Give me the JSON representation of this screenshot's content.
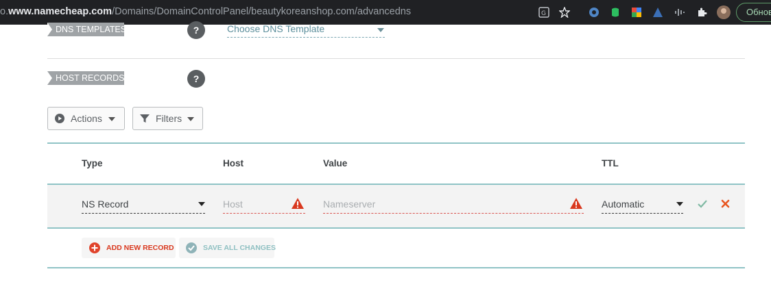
{
  "browser": {
    "url_prefix": "o.",
    "url_domain": "www.namecheap.com",
    "url_path": "/Domains/DomainControlPanel/beautykoreanshop.com/advancedns",
    "update_label": "Обнов"
  },
  "dns_templates": {
    "label": "DNS TEMPLATES",
    "help": "?",
    "select_value": "Choose DNS Template"
  },
  "host_records": {
    "label": "HOST RECORDS",
    "help": "?"
  },
  "toolbar": {
    "actions_label": "Actions",
    "filters_label": "Filters"
  },
  "table": {
    "columns": [
      "Type",
      "Host",
      "Value",
      "TTL"
    ],
    "row": {
      "type": "NS Record",
      "host_placeholder": "Host",
      "value_placeholder": "Nameserver",
      "ttl": "Automatic"
    }
  },
  "footer": {
    "add_label": "ADD NEW RECORD",
    "save_label": "SAVE ALL CHANGES"
  },
  "colors": {
    "accent_teal": "#8fc3c5",
    "error_red": "#d9534f",
    "confirm_green": "#7fb9a3",
    "cancel_orange": "#e8541e"
  }
}
